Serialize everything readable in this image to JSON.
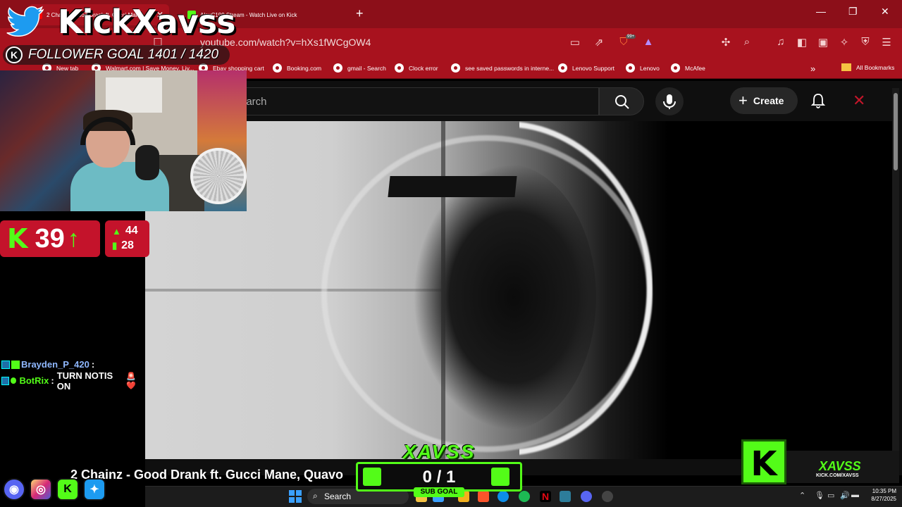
{
  "browser": {
    "tabs": [
      {
        "label": "2 Chainz - Good Drank ft. Gucci Mane, Qua...",
        "active": true
      },
      {
        "label": "AlexC199 Stream - Watch Live on Kick",
        "active": false
      }
    ],
    "new_tab_label": "+",
    "url": "youtube.com/watch?v=hXs1fWCgOW4",
    "extension_badge": "99+",
    "bookmarks": [
      "New tab",
      "Walmart.com | Save Money. Liv...",
      "Ebay shopping cart",
      "Booking.com",
      "gmail - Search",
      "Clock error",
      "see saved passwords in interne...",
      "Lenovo Support",
      "Lenovo",
      "McAfee"
    ],
    "all_bookmarks": "All Bookmarks",
    "overflow": "»"
  },
  "youtube": {
    "search_placeholder": "earch",
    "create_label": "Create"
  },
  "overlay": {
    "brand": "KickXavss",
    "follower_goal": "FOLLOWER GOAL 1401 / 1420",
    "kick_count": "39",
    "stat_up": "44",
    "stat_bars": "28",
    "chat": [
      {
        "user": "Brayden_P_420",
        "message": "",
        "emote": "🕯"
      },
      {
        "user": "BotRix",
        "message": "TURN NOTIS ON",
        "emote": "🚨 ❤️"
      }
    ],
    "now_playing": "2 Chainz - Good Drank ft. Gucci Mane, Quavo",
    "sub_goal_logo": "XAVSS",
    "sub_goal_count": "0 / 1",
    "sub_goal_label": "SUB GOAL",
    "brand_name": "XAVSS",
    "brand_url": "KICK.COM/XAVSS"
  },
  "taskbar": {
    "search_label": "Search",
    "time": "10:35 PM",
    "date": "8/27/2025"
  },
  "colors": {
    "kick_green": "#53fc18",
    "browser_red": "#a8121e",
    "twitter_blue": "#1d9bf0"
  }
}
